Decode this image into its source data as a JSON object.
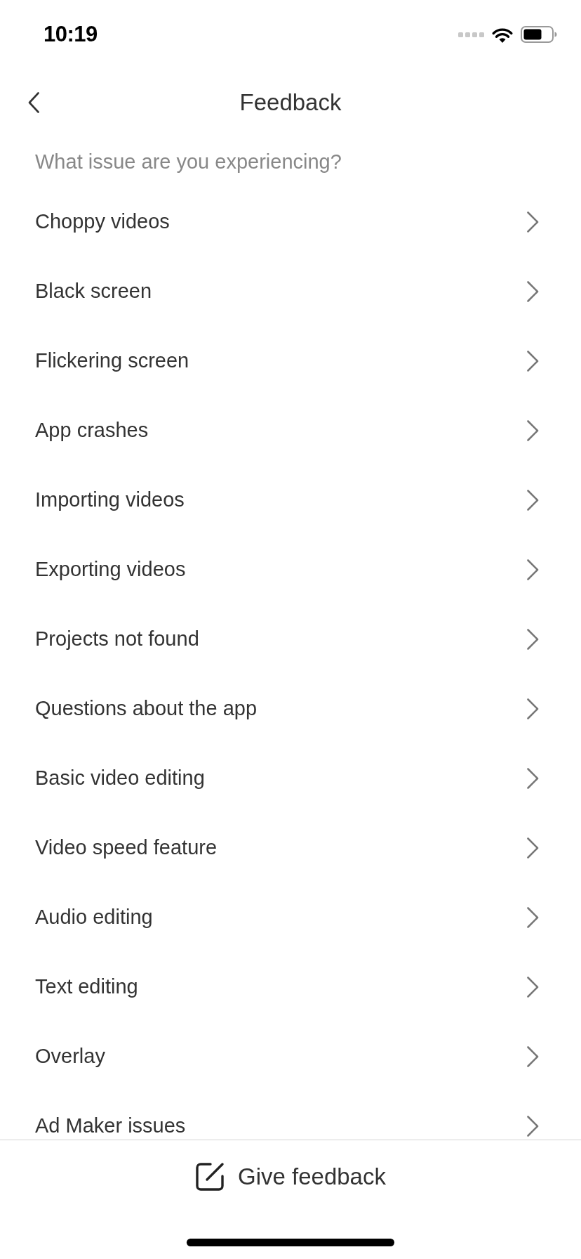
{
  "status_bar": {
    "time": "10:19"
  },
  "header": {
    "title": "Feedback"
  },
  "prompt": "What issue are you experiencing?",
  "issues": [
    "Choppy videos",
    "Black screen",
    "Flickering screen",
    "App crashes",
    "Importing videos",
    "Exporting videos",
    "Projects not found",
    "Questions about the app",
    "Basic video editing",
    "Video speed feature",
    "Audio editing",
    "Text editing",
    "Overlay",
    "Ad Maker issues"
  ],
  "footer": {
    "button": "Give feedback"
  }
}
